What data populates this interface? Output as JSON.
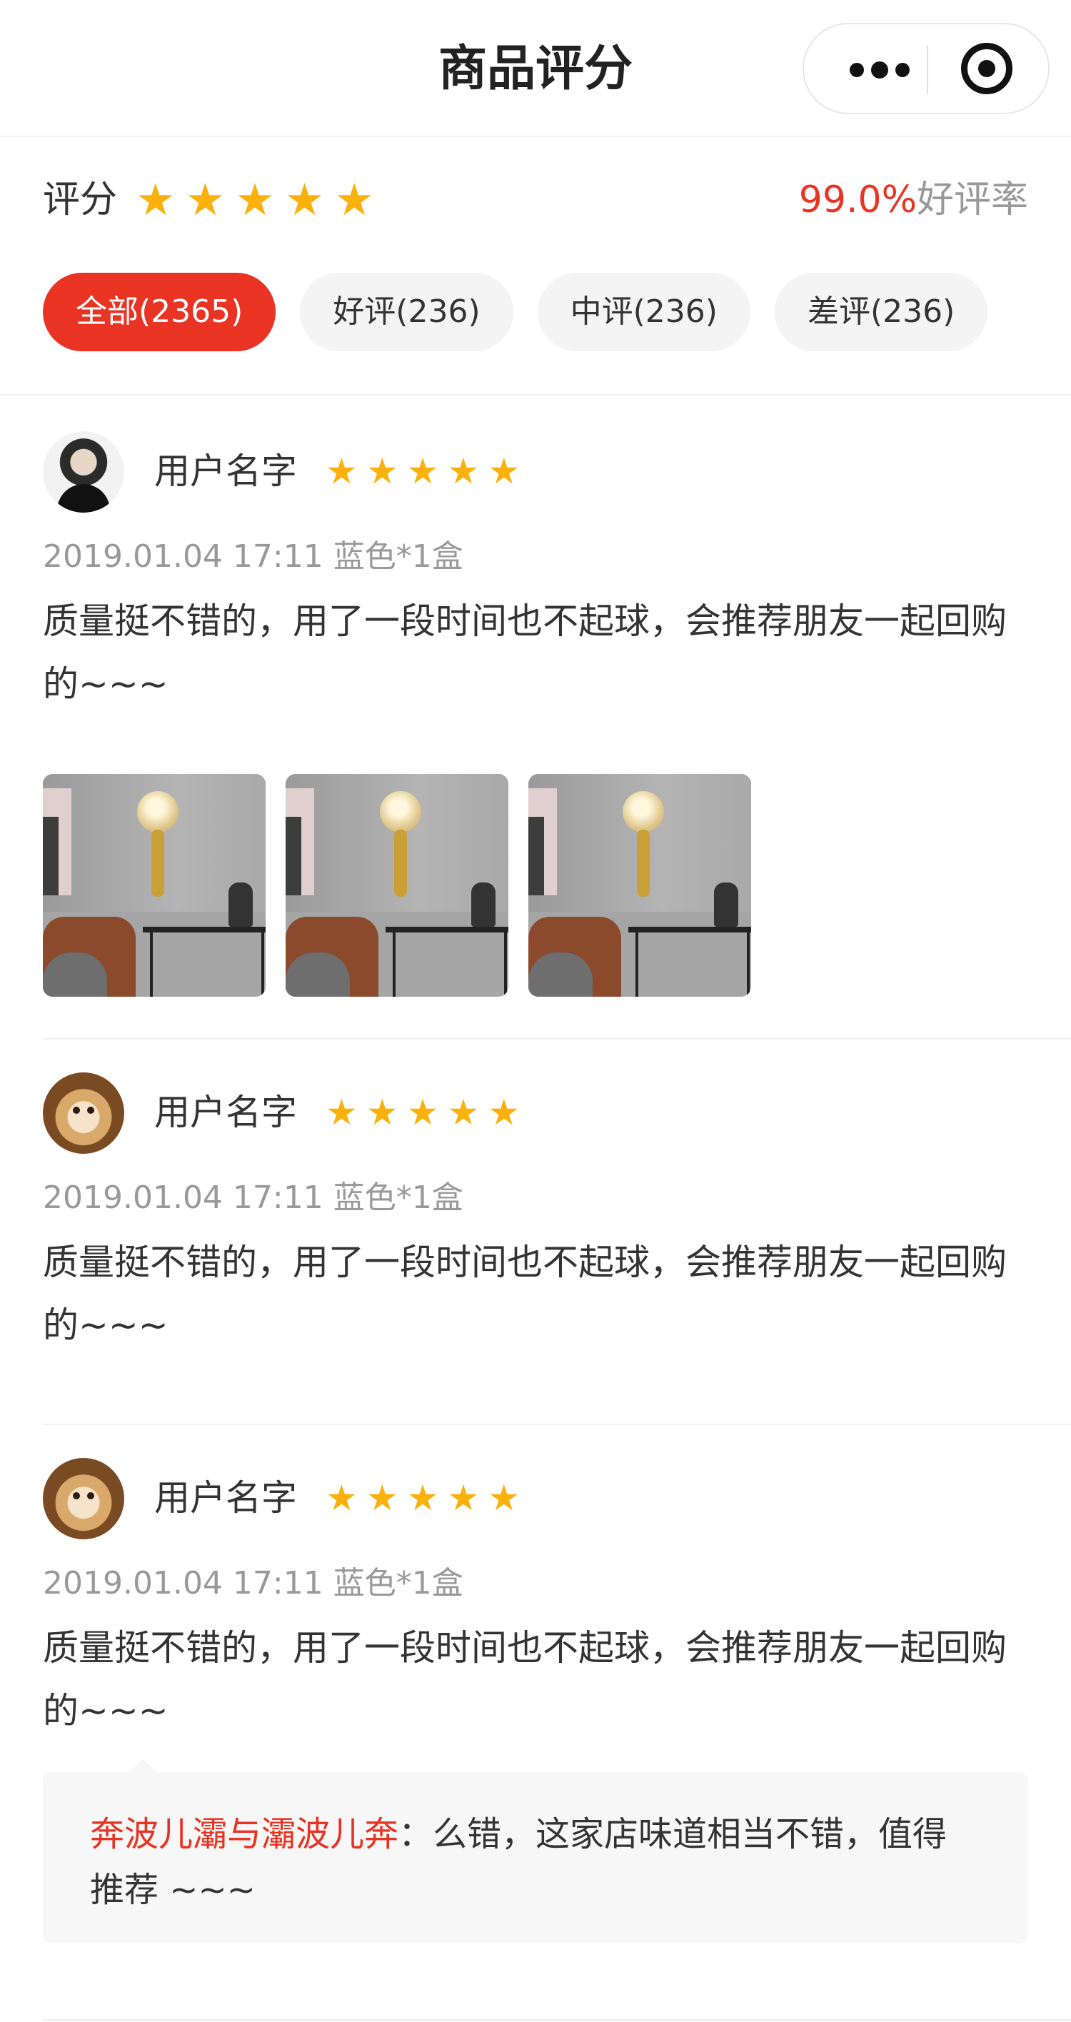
{
  "nav": {
    "title": "商品评分",
    "more_icon": "more-dots-icon",
    "close_icon": "target-circle-icon"
  },
  "score": {
    "label": "评分",
    "rating_stars": 5,
    "positive_rate": "99.0%",
    "positive_rate_label": "好评率"
  },
  "tabs": [
    {
      "label": "全部(2365)",
      "active": true
    },
    {
      "label": "好评(236)",
      "active": false
    },
    {
      "label": "中评(236)",
      "active": false
    },
    {
      "label": "差评(236)",
      "active": false
    }
  ],
  "reviews": [
    {
      "username": "用户名字",
      "stars": 5,
      "meta": "2019.01.04 17:11 蓝色*1盒",
      "text": "质量挺不错的，用了一段时间也不起球，会推荐朋友一起回购的~~~",
      "avatar": "person-avatar",
      "photos": [
        "wall-lamp-photo",
        "wall-lamp-photo",
        "wall-lamp-photo"
      ]
    },
    {
      "username": "用户名字",
      "stars": 5,
      "meta": "2019.01.04 17:11 蓝色*1盒",
      "text": "质量挺不错的，用了一段时间也不起球，会推荐朋友一起回购的~~~",
      "avatar": "dog-avatar"
    },
    {
      "username": "用户名字",
      "stars": 5,
      "meta": "2019.01.04 17:11 蓝色*1盒",
      "text": "质量挺不错的，用了一段时间也不起球，会推荐朋友一起回购的~~~",
      "avatar": "dog-avatar",
      "reply": {
        "name": "奔波儿灞与灞波儿奔",
        "separator": "：",
        "text": "么错，这家店味道相当不错，值得推荐 ~~~"
      }
    }
  ],
  "colors": {
    "accent": "#e93323",
    "star": "#fbb10b",
    "muted": "#999999",
    "tab_bg": "#f4f4f4"
  }
}
